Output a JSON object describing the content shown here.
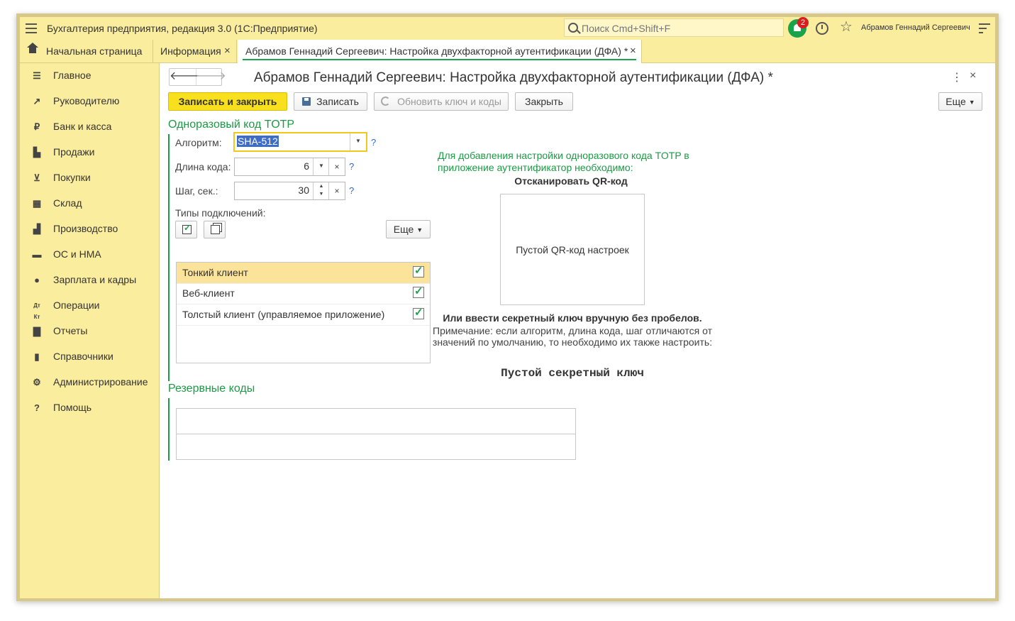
{
  "window": {
    "app_title": "Бухгалтерия предприятия, редакция 3.0  (1С:Предприятие)",
    "search_placeholder": "Поиск Cmd+Shift+F",
    "notification_count": "2",
    "user_name": "Абрамов Геннадий Сергеевич"
  },
  "tabs": [
    {
      "label": "Начальная страница"
    },
    {
      "label": "Информация",
      "close": "×"
    },
    {
      "label": "Абрамов Геннадий Сергеевич: Настройка двухфакторной аутентификации (ДФА) *",
      "close": "×"
    }
  ],
  "sidebar": {
    "items": [
      {
        "label": "Главное",
        "icon": "list-icon"
      },
      {
        "label": "Руководителю",
        "icon": "trend-icon"
      },
      {
        "label": "Банк и касса",
        "icon": "ruble-icon"
      },
      {
        "label": "Продажи",
        "icon": "bag-icon"
      },
      {
        "label": "Покупки",
        "icon": "cart-icon"
      },
      {
        "label": "Склад",
        "icon": "warehouse-icon"
      },
      {
        "label": "Производство",
        "icon": "factory-icon"
      },
      {
        "label": "ОС и НМА",
        "icon": "truck-icon"
      },
      {
        "label": "Зарплата и кадры",
        "icon": "person-icon"
      },
      {
        "label": "Операции",
        "icon": "dt-kt-icon"
      },
      {
        "label": "Отчеты",
        "icon": "bar-chart-icon"
      },
      {
        "label": "Справочники",
        "icon": "books-icon"
      },
      {
        "label": "Администрирование",
        "icon": "gear-icon"
      },
      {
        "label": "Помощь",
        "icon": "question-icon"
      }
    ]
  },
  "form": {
    "title": "Абрамов Геннадий Сергеевич: Настройка двухфакторной аутентификации (ДФА) *",
    "toolbar": {
      "save_close": "Записать и закрыть",
      "save": "Записать",
      "refresh": "Обновить ключ и коды",
      "close": "Закрыть",
      "more": "Еще"
    },
    "totp_section": {
      "title": "Одноразовый код TOTP",
      "algorithm_label": "Алгоритм:",
      "algorithm_value": "SHA-512",
      "code_length_label": "Длина кода:",
      "code_length_value": "6",
      "step_label": "Шаг, сек.:",
      "step_value": "30",
      "help": "?",
      "connection_types_label": "Типы подключений:",
      "more": "Еще",
      "connection_types": [
        {
          "label": "Тонкий клиент",
          "checked": true
        },
        {
          "label": "Веб-клиент",
          "checked": true
        },
        {
          "label": "Толстый клиент (управляемое приложение)",
          "checked": true
        }
      ]
    },
    "qr_panel": {
      "instruction": "Для добавления настройки одноразового кода TOTP в приложение аутентификатор необходимо:",
      "scan_title": "Отсканировать QR-код",
      "qr_placeholder": "Пустой QR-код настроек",
      "manual_title": "Или ввести секретный ключ вручную без пробелов.",
      "note": "Примечание: если алгоритм, длина кода, шаг отличаются от значений по умолчанию, то необходимо их также настроить:",
      "secret_key": "Пустой секретный ключ"
    },
    "reserve_section": {
      "title": "Резервные коды"
    }
  }
}
